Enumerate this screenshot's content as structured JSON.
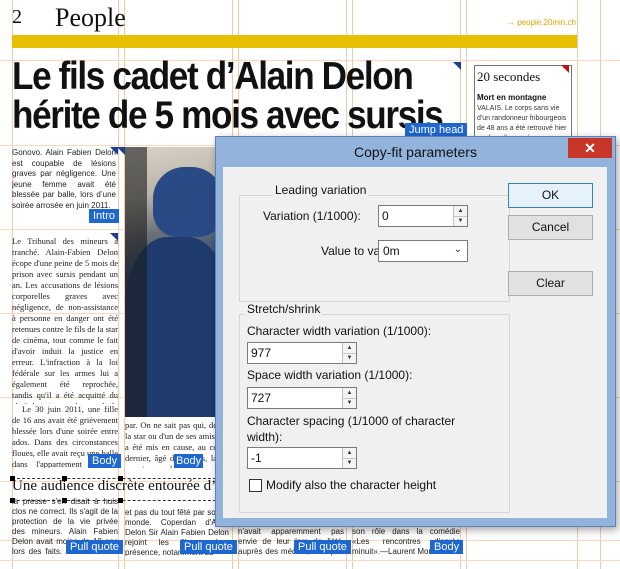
{
  "page": {
    "page_number": "2",
    "section": "People",
    "url": "→ people.20min.ch",
    "headline_line1": "Le fils cadet d’Alain Delon",
    "headline_line2": "hérite de 5 mois avec sursis",
    "jump_head_tag": "Jump head",
    "intro_tag": "Intro",
    "body_tag": "Body",
    "pull_quote_tag": "Pull quote",
    "sidebar_title": "20 secondes",
    "sidebar_heading": "Mort en montagne",
    "sidebar_text": "VALAIS. Le corps sans vie d'un randonneur fribourgeois de 48 ans a été retrouvé hier par la police après un",
    "intro_text": "Gonovo. Alain Fabien Delon est coupable de lésions graves par négligence. Une jeune femme avait été blessée par balle, lors d’une soirée arrosée en juin 2011.",
    "body_text_1": "Le Tribunal des mineurs a tranché. Alain-Fabien Delon écope d'une peine de 5 mois de prison avec sursis pendant un an. Les accusations de lésions corporelles graves avec négligence, de non-assistance à personne en danger ont été retenues contre le fils de la star de cinéma, tout comme le fait d'avoir induit la justice en erreur. L'infraction à la loi fédérale sur les armes lui a également été reprochée, tandis qu'il a été acquitté du chef de mise en danger de la vie d'autrui. «Cette issue me paraît équilibrée», a assuré son avocat, Me Alec Reymond.",
    "body_text_2": "Le 30 juin 2011, une fille de 16 ans avait été grièvement blessée lors d'une soirée entre ados. Dans des circonstances floues, elle avait reçu une balle dans l'appartement d'Alain-Fabien Delon, dans le quartier des",
    "body_text_3": "par. On ne sait pas qui, de la star ou d'un de ses amis, a été mis en cause, au ce dernier, âgé de 17 ans, la semaine prochaine.",
    "subhead": "Une audience discrète entourée d’une",
    "bottom_text_1": "la presse s'en disait à huis clos ne correct. Ils s'agit de la protection de la vie privée des mineurs. Alain Fabien Delon avait moins de 18 ans lors des faits. Mais la cause lors du procès le médiatique de l'affaire",
    "bottom_text_2": "et pas du tout fêté par son le monde. Coperdan d'Alain Delon Sir Alain Fabien Delon rejoint les films»; leur présence, notamment du",
    "bottom_text_3": "n'avait apparemment pas envie de leur lors de l'été, auprès des médias, à un peu de l'image, aussi peut-être",
    "bottom_text_4": "son rôle dans la comédie «Les rencontres d'après minuit».—Laurent Mor"
  },
  "dialog": {
    "title": "Copy-fit parameters",
    "close_glyph": "✕",
    "leading_group": "Leading variation",
    "variation_label": "Variation (1/1000):",
    "variation_value": "0",
    "value_to_vary_label": "Value to vary:",
    "value_to_vary_selected": "0m",
    "stretch_group": "Stretch/shrink",
    "char_width_label": "Character width variation (1/1000):",
    "char_width_value": "977",
    "space_width_label": "Space width variation (1/1000):",
    "space_width_value": "727",
    "char_spacing_label_line1": "Character spacing (1/1000 of character",
    "char_spacing_label_line2": "width):",
    "char_spacing_value": "-1",
    "modify_height_label": "Modify also the character height",
    "modify_height_checked": false,
    "ok_label": "OK",
    "cancel_label": "Cancel",
    "clear_label": "Clear",
    "spin_up_glyph": "▲",
    "spin_down_glyph": "▼",
    "dropdown_glyph": "⌄"
  },
  "colors": {
    "accent_yellow": "#e6c000",
    "frame_tag_blue": "#1e66d0",
    "dialog_frame": "#92b3dc",
    "close_red": "#c8362a"
  }
}
